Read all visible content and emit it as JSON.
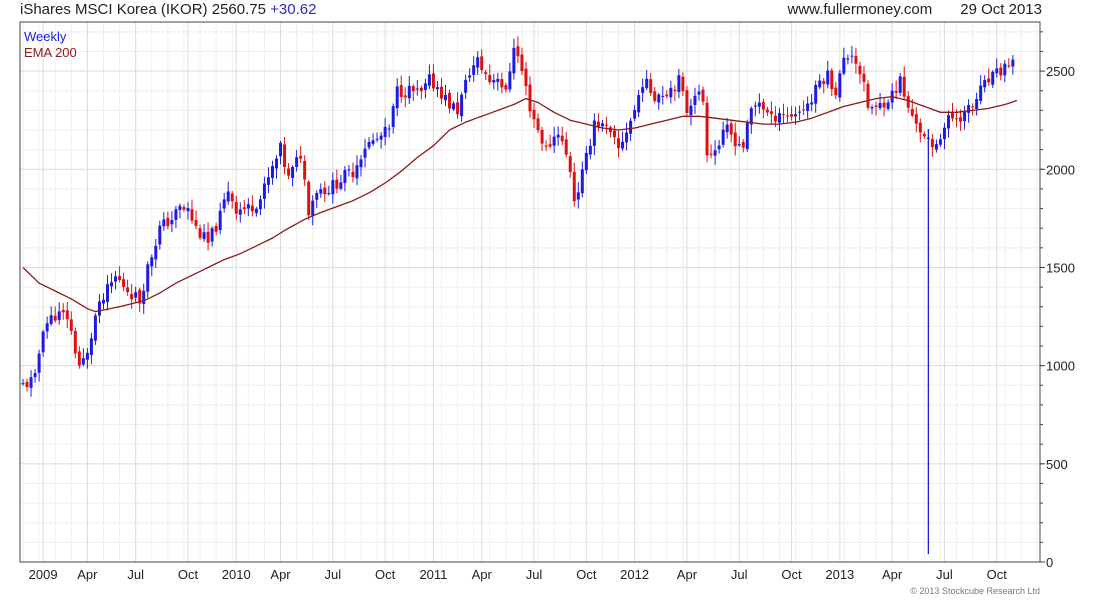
{
  "header": {
    "title": "iShares MSCI Korea (IKOR)",
    "price": "2560.75",
    "change": "+30.62",
    "site": "www.fullermoney.com",
    "date": "29 Oct 2013"
  },
  "footer": {
    "copyright": "© 2013 Stockcube Research Ltd"
  },
  "colors": {
    "up": "#1c1ce0",
    "down": "#dd1111",
    "ema": "#8b1a1a",
    "grid": "#dcdcdc",
    "frame": "#444444"
  },
  "chart_data": {
    "type": "candlestick",
    "legend": [
      {
        "label": "Weekly",
        "color": "#1c1ce0"
      },
      {
        "label": "EMA 200",
        "color": "#8b1a1a"
      }
    ],
    "ylim": [
      0,
      2750
    ],
    "y_ticks": [
      0,
      500,
      1000,
      1500,
      2000,
      2500
    ],
    "x_labels": [
      "2009",
      "Apr",
      "Jul",
      "Oct",
      "2010",
      "Apr",
      "Jul",
      "Oct",
      "2011",
      "Apr",
      "Jul",
      "Oct",
      "2012",
      "Apr",
      "Jul",
      "Oct",
      "2013",
      "Apr",
      "Jul",
      "Oct"
    ],
    "x_label_weeks": [
      5,
      16,
      28,
      41,
      53,
      64,
      77,
      90,
      102,
      114,
      127,
      140,
      152,
      165,
      178,
      191,
      203,
      216,
      229,
      242
    ],
    "x_range_weeks": [
      0,
      252
    ],
    "close_anchors": [
      [
        0,
        900
      ],
      [
        3,
        930
      ],
      [
        5,
        1200
      ],
      [
        8,
        1260
      ],
      [
        11,
        1250
      ],
      [
        14,
        1000
      ],
      [
        16,
        1050
      ],
      [
        18,
        1250
      ],
      [
        21,
        1380
      ],
      [
        23,
        1450
      ],
      [
        27,
        1370
      ],
      [
        29,
        1330
      ],
      [
        31,
        1500
      ],
      [
        34,
        1700
      ],
      [
        37,
        1750
      ],
      [
        39,
        1800
      ],
      [
        41,
        1790
      ],
      [
        43,
        1700
      ],
      [
        46,
        1620
      ],
      [
        49,
        1760
      ],
      [
        51,
        1900
      ],
      [
        53,
        1800
      ],
      [
        56,
        1800
      ],
      [
        59,
        1850
      ],
      [
        62,
        2000
      ],
      [
        64,
        2100
      ],
      [
        66,
        1950
      ],
      [
        69,
        2080
      ],
      [
        71,
        1800
      ],
      [
        73,
        1900
      ],
      [
        76,
        1900
      ],
      [
        79,
        1950
      ],
      [
        82,
        1990
      ],
      [
        85,
        2120
      ],
      [
        88,
        2150
      ],
      [
        91,
        2200
      ],
      [
        93,
        2400
      ],
      [
        96,
        2400
      ],
      [
        99,
        2380
      ],
      [
        101,
        2450
      ],
      [
        103,
        2420
      ],
      [
        106,
        2330
      ],
      [
        108,
        2300
      ],
      [
        111,
        2500
      ],
      [
        113,
        2550
      ],
      [
        116,
        2450
      ],
      [
        118,
        2480
      ],
      [
        120,
        2380
      ],
      [
        122,
        2640
      ],
      [
        124,
        2500
      ],
      [
        126,
        2320
      ],
      [
        128,
        2200
      ],
      [
        130,
        2100
      ],
      [
        133,
        2200
      ],
      [
        136,
        2000
      ],
      [
        137,
        1850
      ],
      [
        138,
        1900
      ],
      [
        140,
        2050
      ],
      [
        142,
        2250
      ],
      [
        145,
        2200
      ],
      [
        148,
        2100
      ],
      [
        150,
        2200
      ],
      [
        152,
        2300
      ],
      [
        154,
        2450
      ],
      [
        157,
        2380
      ],
      [
        160,
        2400
      ],
      [
        163,
        2450
      ],
      [
        165,
        2300
      ],
      [
        167,
        2400
      ],
      [
        169,
        2350
      ],
      [
        170,
        2100
      ],
      [
        172,
        2100
      ],
      [
        175,
        2200
      ],
      [
        177,
        2150
      ],
      [
        179,
        2120
      ],
      [
        181,
        2300
      ],
      [
        183,
        2350
      ],
      [
        186,
        2250
      ],
      [
        188,
        2300
      ],
      [
        190,
        2270
      ],
      [
        193,
        2300
      ],
      [
        196,
        2350
      ],
      [
        198,
        2450
      ],
      [
        200,
        2480
      ],
      [
        202,
        2400
      ],
      [
        204,
        2550
      ],
      [
        206,
        2600
      ],
      [
        208,
        2500
      ],
      [
        210,
        2320
      ],
      [
        212,
        2300
      ],
      [
        214,
        2350
      ],
      [
        216,
        2380
      ],
      [
        218,
        2450
      ],
      [
        220,
        2300
      ],
      [
        222,
        2250
      ],
      [
        224,
        2150
      ],
      [
        226,
        2100
      ],
      [
        228,
        2180
      ],
      [
        230,
        2250
      ],
      [
        232,
        2270
      ],
      [
        234,
        2280
      ],
      [
        236,
        2320
      ],
      [
        238,
        2400
      ],
      [
        240,
        2450
      ],
      [
        242,
        2480
      ],
      [
        244,
        2520
      ],
      [
        246,
        2560
      ]
    ],
    "ema_anchors": [
      [
        0,
        1500
      ],
      [
        4,
        1420
      ],
      [
        8,
        1380
      ],
      [
        12,
        1340
      ],
      [
        16,
        1290
      ],
      [
        18,
        1275
      ],
      [
        24,
        1300
      ],
      [
        30,
        1330
      ],
      [
        34,
        1370
      ],
      [
        38,
        1420
      ],
      [
        42,
        1460
      ],
      [
        46,
        1500
      ],
      [
        50,
        1540
      ],
      [
        54,
        1570
      ],
      [
        58,
        1610
      ],
      [
        62,
        1650
      ],
      [
        66,
        1700
      ],
      [
        70,
        1745
      ],
      [
        74,
        1780
      ],
      [
        78,
        1810
      ],
      [
        82,
        1840
      ],
      [
        86,
        1880
      ],
      [
        90,
        1930
      ],
      [
        94,
        1990
      ],
      [
        98,
        2060
      ],
      [
        102,
        2120
      ],
      [
        106,
        2200
      ],
      [
        110,
        2240
      ],
      [
        114,
        2270
      ],
      [
        118,
        2300
      ],
      [
        122,
        2330
      ],
      [
        125,
        2360
      ],
      [
        128,
        2340
      ],
      [
        132,
        2290
      ],
      [
        136,
        2250
      ],
      [
        140,
        2230
      ],
      [
        144,
        2210
      ],
      [
        148,
        2200
      ],
      [
        152,
        2210
      ],
      [
        156,
        2230
      ],
      [
        160,
        2250
      ],
      [
        164,
        2270
      ],
      [
        168,
        2270
      ],
      [
        172,
        2260
      ],
      [
        176,
        2250
      ],
      [
        180,
        2240
      ],
      [
        184,
        2230
      ],
      [
        188,
        2230
      ],
      [
        192,
        2240
      ],
      [
        196,
        2260
      ],
      [
        200,
        2290
      ],
      [
        204,
        2320
      ],
      [
        208,
        2340
      ],
      [
        212,
        2360
      ],
      [
        216,
        2370
      ],
      [
        220,
        2350
      ],
      [
        224,
        2320
      ],
      [
        228,
        2290
      ],
      [
        232,
        2290
      ],
      [
        236,
        2300
      ],
      [
        240,
        2310
      ],
      [
        244,
        2330
      ],
      [
        247,
        2350
      ]
    ],
    "spike": {
      "week": 225,
      "low": 40
    }
  }
}
